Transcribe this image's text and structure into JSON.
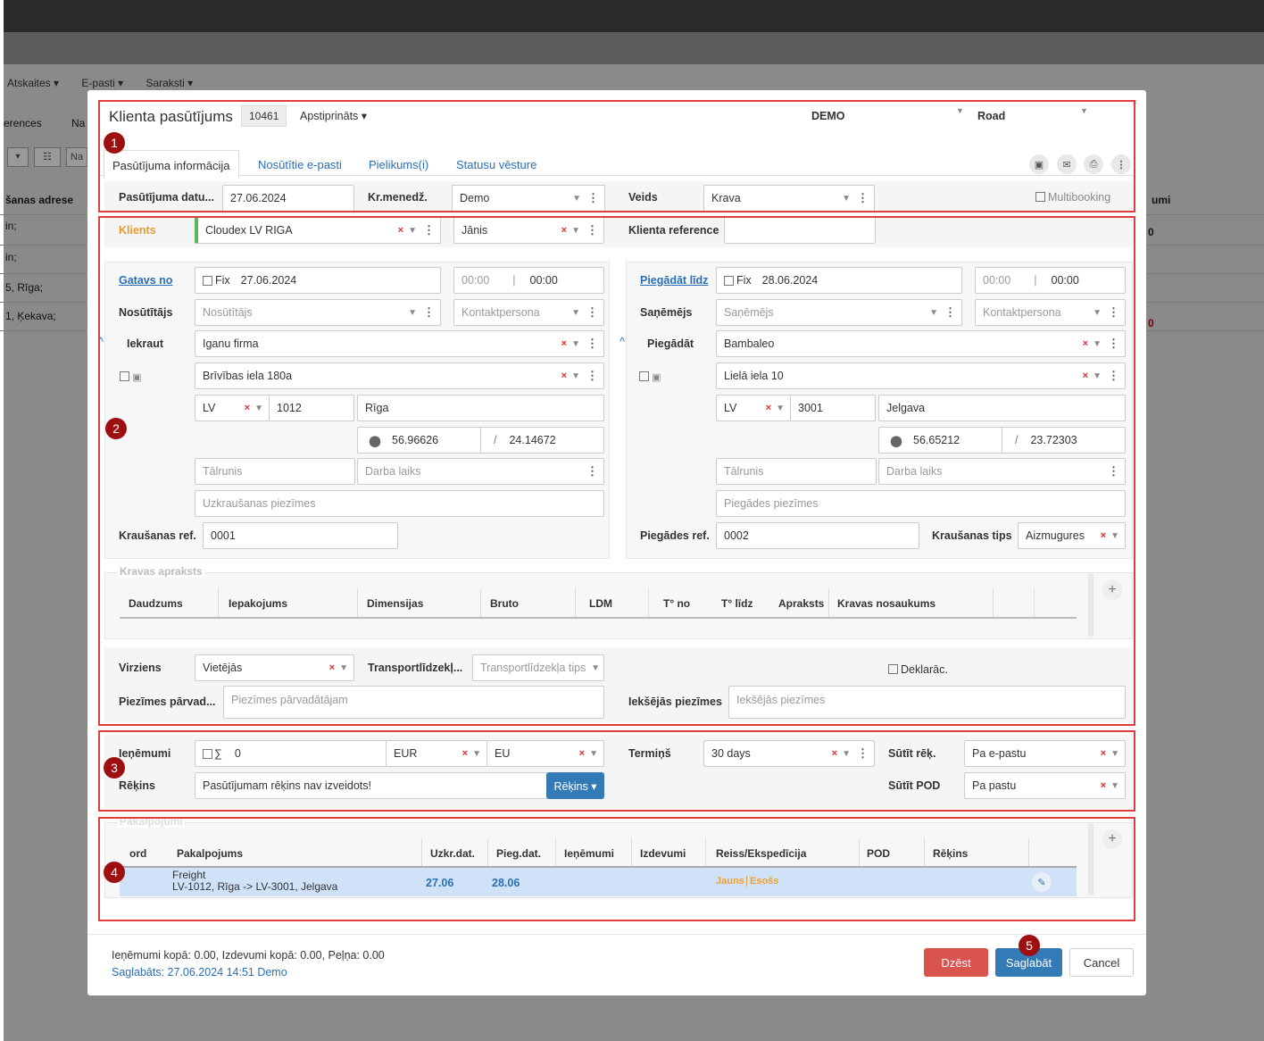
{
  "background": {
    "menu": [
      "Atskaites ▾",
      "E-pasti ▾",
      "Saraksti ▾"
    ],
    "side_labels": [
      "erences",
      "Na"
    ],
    "col_header": "šanas adrese",
    "col_header_right": "umi",
    "rows": [
      "in;",
      "in;",
      "5, Rīga;",
      "1, Ķekava;"
    ],
    "row_right": [
      "0",
      "0"
    ]
  },
  "header": {
    "title": "Klienta pasūtījums",
    "order_no": "10461",
    "status": "Apstiprināts",
    "company": "DEMO",
    "mode": "Road"
  },
  "tabs": [
    "Pasūtījuma informācija",
    "Nosūtītie e-pasti",
    "Pielikums(i)",
    "Statusu vēsture"
  ],
  "info_row": {
    "date_label": "Pasūtījuma datu...",
    "date_value": "27.06.2024",
    "manager_label": "Kr.menedž.",
    "manager_value": "Demo",
    "type_label": "Veids",
    "type_value": "Krava",
    "multibooking": "Multibooking"
  },
  "client": {
    "label": "Klients",
    "value": "Cloudex LV RIGA",
    "contact": "Jānis",
    "ref_label": "Klienta reference",
    "ref_value": ""
  },
  "pickup": {
    "ready_label": "Gatavs no",
    "fix": "Fix",
    "date": "27.06.2024",
    "time_from": "00:00",
    "time_sep": "|",
    "time_to": "00:00",
    "sender_label": "Nosūtītājs",
    "sender_ph": "Nosūtītājs",
    "contact_ph": "Kontaktpersona",
    "load_label": "Iekraut",
    "load_value": "Iganu firma",
    "address": "Brīvības iela 180a",
    "country": "LV",
    "zip": "1012",
    "city": "Rīga",
    "lat": "56.96626",
    "slash": "/",
    "lng": "24.14672",
    "phone_ph": "Tālrunis",
    "hours_ph": "Darba laiks",
    "notes_ph": "Uzkraušanas piezīmes",
    "ref_label": "Kraušanas ref.",
    "ref_value": "0001"
  },
  "delivery": {
    "deliver_label": "Piegādāt līdz",
    "fix": "Fix",
    "date": "28.06.2024",
    "time_from": "00:00",
    "time_sep": "|",
    "time_to": "00:00",
    "receiver_label": "Saņēmējs",
    "receiver_ph": "Saņēmējs",
    "contact_ph": "Kontaktpersona",
    "deliv_label": "Piegādāt",
    "deliv_value": "Bambaleo",
    "address": "Lielā iela 10",
    "country": "LV",
    "zip": "3001",
    "city": "Jelgava",
    "lat": "56.65212",
    "slash": "/",
    "lng": "23.72303",
    "phone_ph": "Tālrunis",
    "hours_ph": "Darba laiks",
    "notes_ph": "Piegādes piezīmes",
    "ref_label": "Piegādes ref.",
    "ref_value": "0002",
    "loading_type_label": "Kraušanas tips",
    "loading_type_value": "Aizmugures"
  },
  "cargo": {
    "legend": "Kravas apraksts",
    "columns": [
      "Daudzums",
      "Iepakojums",
      "Dimensijas",
      "Bruto",
      "LDM",
      "T° no",
      "T° līdz",
      "Apraksts",
      "Kravas nosaukums"
    ]
  },
  "transport": {
    "direction_label": "Virziens",
    "direction_value": "Vietējās",
    "vehicle_label": "Transportlīdzekļ...",
    "vehicle_ph": "Transportlīdzekļa tips",
    "declar": "Deklarāc.",
    "carrier_notes_label": "Piezīmes pārvad...",
    "carrier_notes_ph": "Piezīmes pārvadātājam",
    "internal_notes_label": "Iekšējās piezīmes",
    "internal_notes_ph": "Iekšējās piezīmes"
  },
  "finance": {
    "income_label": "Ieņēmumi",
    "sum_symbol": "∑",
    "income_value": "0",
    "currency": "EUR",
    "region": "EU",
    "term_label": "Termiņš",
    "term_value": "30 days",
    "send_invoice_label": "Sūtīt rēķ.",
    "send_invoice_value": "Pa e-pastu",
    "invoice_label": "Rēķins",
    "invoice_value": "Pasūtījumam rēķins nav izveidots!",
    "invoice_btn": "Rēķins ▾",
    "send_pod_label": "Sūtīt POD",
    "send_pod_value": "Pa pastu"
  },
  "services": {
    "legend": "Pakalpojumi",
    "columns": [
      "ord",
      "Pakalpojums",
      "Uzkr.dat.",
      "Pieg.dat.",
      "Ieņēmumi",
      "Izdevumi",
      "Reiss/Ekspedīcija",
      "POD",
      "Rēķins"
    ],
    "row": {
      "name": "Freight",
      "route": "LV-1012, Rīga -> LV-3001, Jelgava",
      "pickup": "27.06",
      "delivery": "28.06",
      "trip_new": "Jauns",
      "trip_existing": "Esošs"
    }
  },
  "footer": {
    "totals": "Ieņēmumi kopā: 0.00, Izdevumi kopā: 0.00, Peļņa: 0.00",
    "saved": "Saglabāts: 27.06.2024 14:51 Demo",
    "delete": "Dzēst",
    "save": "Saglabāt",
    "cancel": "Cancel"
  },
  "markers": [
    "1",
    "2",
    "3",
    "4",
    "5"
  ],
  "colors": {
    "accent": "#2a6fb5",
    "danger": "#d9534f",
    "marker": "#9e1010",
    "highlight": "#cfe2f7",
    "orange": "#f0a030"
  }
}
